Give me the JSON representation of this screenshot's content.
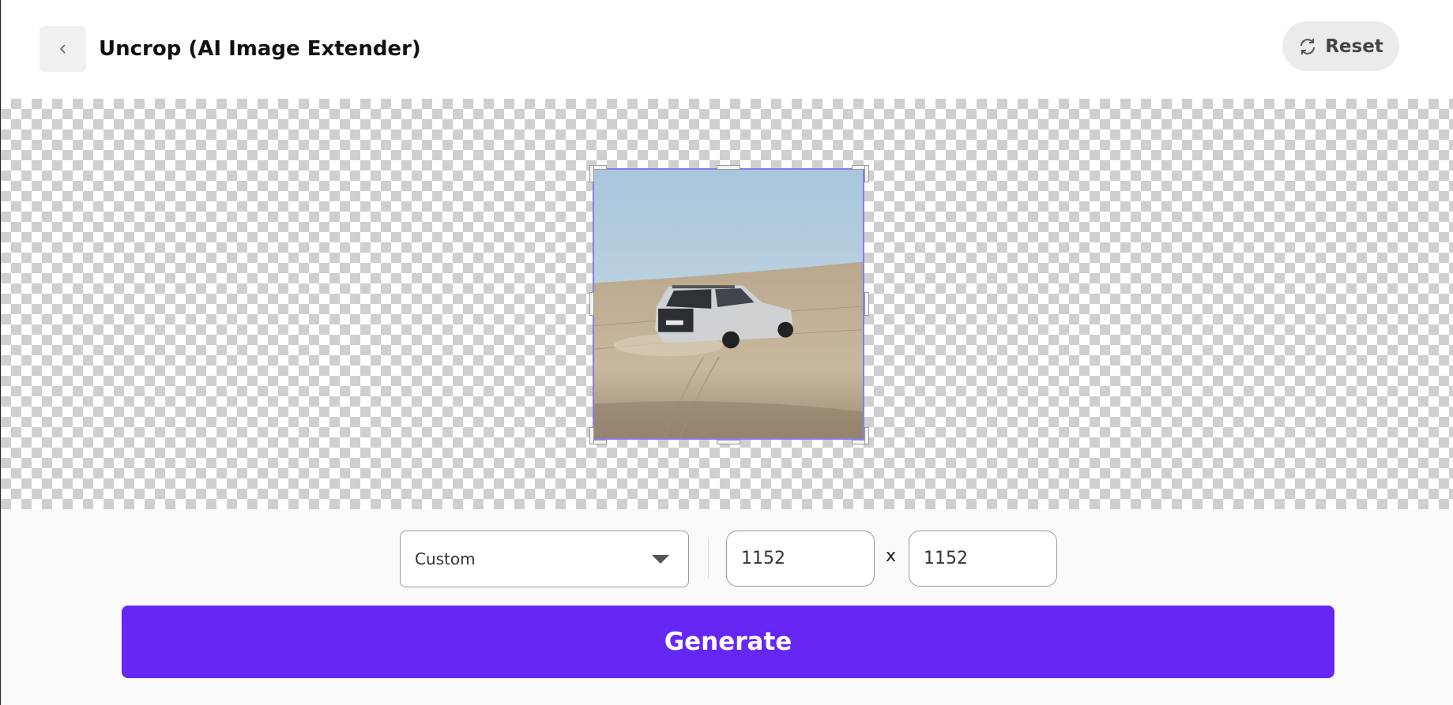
{
  "header": {
    "title": "Uncrop (AI Image Extender)",
    "reset_label": "Reset",
    "back_icon": "chevron-left-icon",
    "reset_icon": "refresh-icon"
  },
  "controls": {
    "aspect_select": {
      "value": "Custom"
    },
    "width": "1152",
    "height": "1152",
    "separator": "x",
    "generate_label": "Generate"
  },
  "colors": {
    "accent": "#6626f4",
    "frame_border": "#8a7ce6"
  }
}
